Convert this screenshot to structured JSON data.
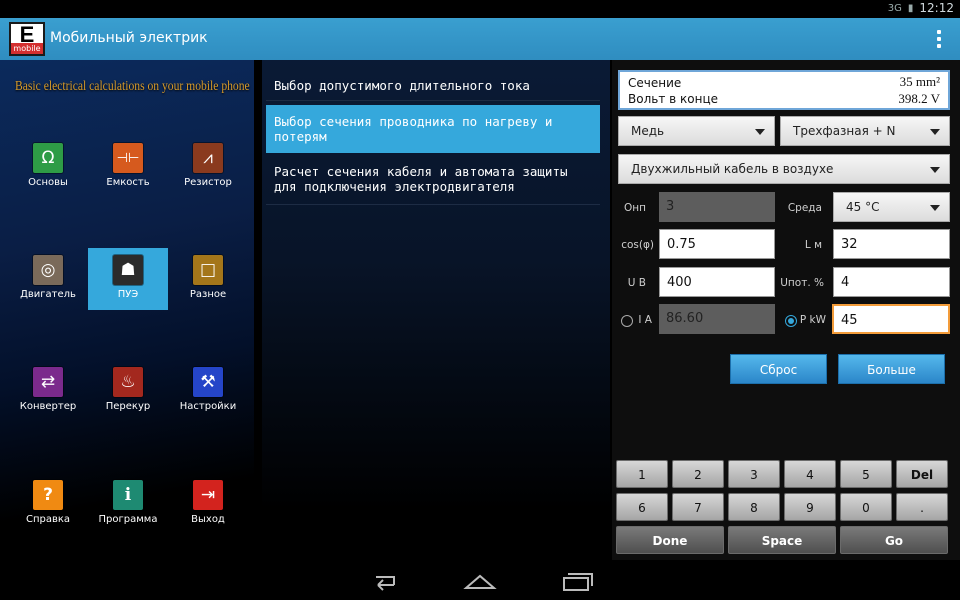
{
  "status": {
    "signal": "3G",
    "time": "12:12"
  },
  "app": {
    "logo_letter": "E",
    "logo_sub": "mobile",
    "title": "Мобильный электрик"
  },
  "left": {
    "tagline": "Basic electrical calculations on your mobile phone",
    "tiles": [
      {
        "label": "Основы",
        "icon": "omega-icon",
        "color": "#2e9c46",
        "glyph": "Ω"
      },
      {
        "label": "Емкость",
        "icon": "capacitor-icon",
        "color": "#d65a1e",
        "glyph": "⊣⊢"
      },
      {
        "label": "Резистор",
        "icon": "resistor-icon",
        "color": "#8a3a1e",
        "glyph": "⩘"
      },
      {
        "label": "Двигатель",
        "icon": "motor-icon",
        "color": "#7a6a5a",
        "glyph": "◎"
      },
      {
        "label": "ПУЭ",
        "icon": "book-icon",
        "color": "#2b2b2b",
        "glyph": "☗"
      },
      {
        "label": "Разное",
        "icon": "square-icon",
        "color": "#a4761a",
        "glyph": "□"
      },
      {
        "label": "Конвертер",
        "icon": "converter-icon",
        "color": "#7b2a8c",
        "glyph": "⇄"
      },
      {
        "label": "Перекур",
        "icon": "cigarette-icon",
        "color": "#a3281e",
        "glyph": "♨"
      },
      {
        "label": "Настройки",
        "icon": "tools-icon",
        "color": "#2545c8",
        "glyph": "⚒"
      },
      {
        "label": "Справка",
        "icon": "help-icon",
        "color": "#f08a12",
        "glyph": "?"
      },
      {
        "label": "Программа",
        "icon": "info-icon",
        "color": "#1e8a72",
        "glyph": "i"
      },
      {
        "label": "Выход",
        "icon": "exit-icon",
        "color": "#d3231e",
        "glyph": "⇥"
      }
    ]
  },
  "menu": [
    {
      "l1": "Выбор допустимого длительного тока",
      "l2": ""
    },
    {
      "l1": "Выбор сечения проводника по нагреву и",
      "l2": "потерям"
    },
    {
      "l1": "Расчет сечения кабеля и автомата защиты",
      "l2": "для подключения электродвигателя"
    }
  ],
  "result": {
    "section_label": "Сечение",
    "section_value": "35 mm²",
    "volt_label": "Вольт в конце",
    "volt_value": "398.2 V"
  },
  "selects": {
    "material": "Медь",
    "phase": "Трехфазная + N",
    "cable": "Двухжильный кабель в воздухе",
    "env": "45 °C"
  },
  "form": {
    "onp_label": "Онп",
    "onp_value": "3",
    "env_label": "Среда",
    "cos_label": "cos(φ)",
    "cos_value": "0.75",
    "l_label": "L м",
    "l_value": "32",
    "u_label": "U В",
    "u_value": "400",
    "upot_label": "Uпот. %",
    "upot_value": "4",
    "i_label": "I A",
    "i_value": "86.60",
    "p_label": "P kW",
    "p_value": "45"
  },
  "buttons": {
    "reset": "Сброс",
    "more": "Больше"
  },
  "keypad": {
    "row1": [
      "1",
      "2",
      "3",
      "4",
      "5",
      "Del"
    ],
    "row2": [
      "6",
      "7",
      "8",
      "9",
      "0",
      "."
    ],
    "row3": [
      "Done",
      "Space",
      "Go"
    ]
  }
}
